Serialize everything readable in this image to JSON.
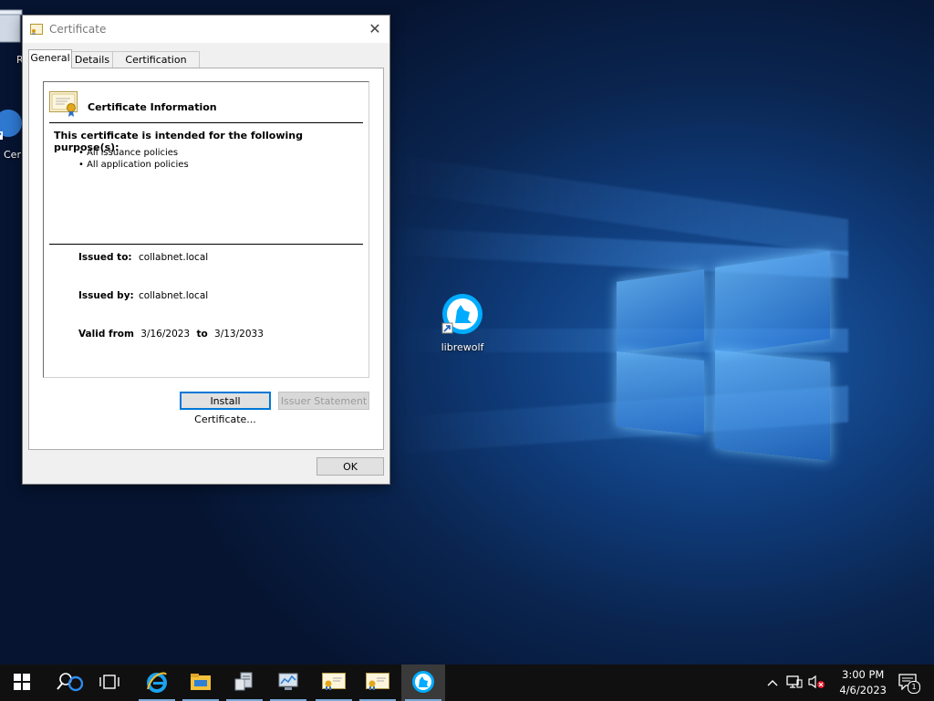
{
  "desktop": {
    "icons": [
      {
        "label": "Re",
        "icon": "recycle-bin-icon"
      },
      {
        "label": "Cer",
        "icon": "certificate-shortcut-icon"
      },
      {
        "label": "librewolf",
        "icon": "librewolf-icon"
      }
    ]
  },
  "dialog": {
    "title": "Certificate",
    "close_glyph": "✕",
    "tabs": [
      {
        "label": "General",
        "active": true
      },
      {
        "label": "Details",
        "active": false
      },
      {
        "label": "Certification Path",
        "active": false
      }
    ],
    "info_header": "Certificate Information",
    "purpose_heading": "This certificate is intended for the following purpose(s):",
    "purposes": [
      "• All issuance policies",
      "• All application policies"
    ],
    "issued_to_label": "Issued to:",
    "issued_to_value": "collabnet.local",
    "issued_by_label": "Issued by:",
    "issued_by_value": "collabnet.local",
    "valid_from_label": "Valid from",
    "valid_from_value": "3/16/2023",
    "valid_to_label": "to",
    "valid_to_value": "3/13/2033",
    "install_button": "Install Certificate...",
    "issuer_statement_button": "Issuer Statement",
    "ok_button": "OK"
  },
  "taskbar": {
    "apps": [
      {
        "icon": "start-icon"
      },
      {
        "icon": "search-icon"
      },
      {
        "icon": "task-view-icon"
      },
      {
        "icon": "internet-explorer-icon"
      },
      {
        "icon": "file-explorer-icon"
      },
      {
        "icon": "server-manager-icon"
      },
      {
        "icon": "network-monitor-icon"
      },
      {
        "icon": "certificate-icon"
      },
      {
        "icon": "certificate-icon"
      },
      {
        "icon": "librewolf-icon"
      }
    ],
    "time": "3:00 PM",
    "date": "4/6/2023",
    "notification_count": "1",
    "accent": "#0078d7"
  }
}
